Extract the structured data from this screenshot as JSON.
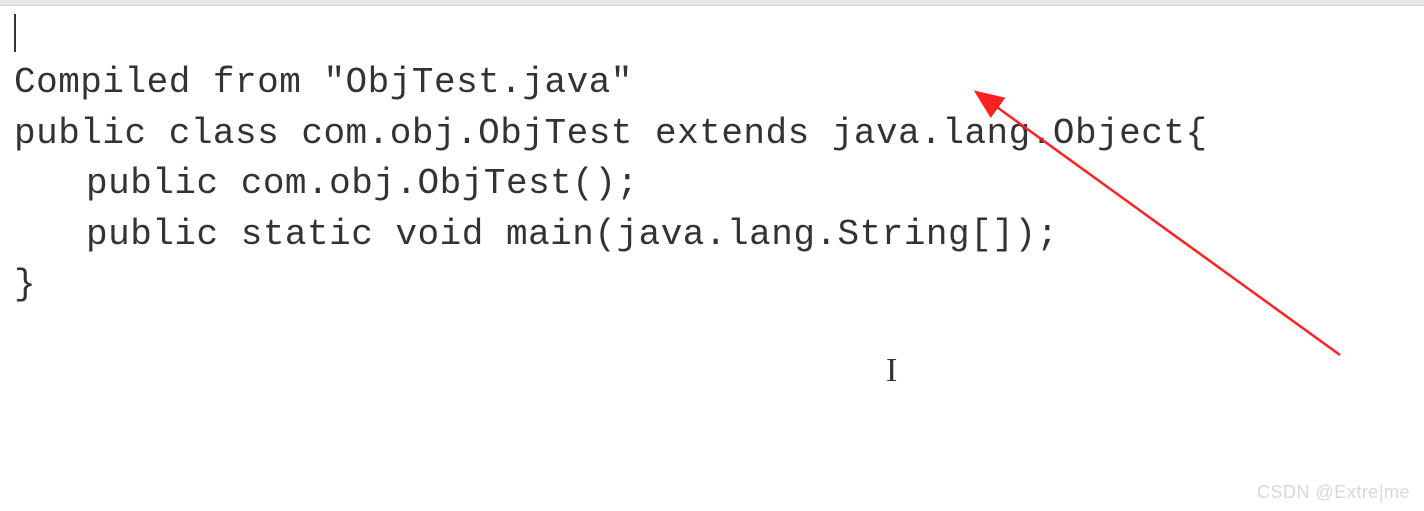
{
  "code": {
    "line1": "Compiled from \"ObjTest.java\"",
    "line2": "public class com.obj.ObjTest extends java.lang.Object{",
    "line3": "public com.obj.ObjTest();",
    "line4": "public static void main(java.lang.String[]);",
    "line5": "}"
  },
  "cursor": {
    "ibeam": "I"
  },
  "watermark": "CSDN @Extre|me",
  "arrow": {
    "color": "#ff2020"
  }
}
